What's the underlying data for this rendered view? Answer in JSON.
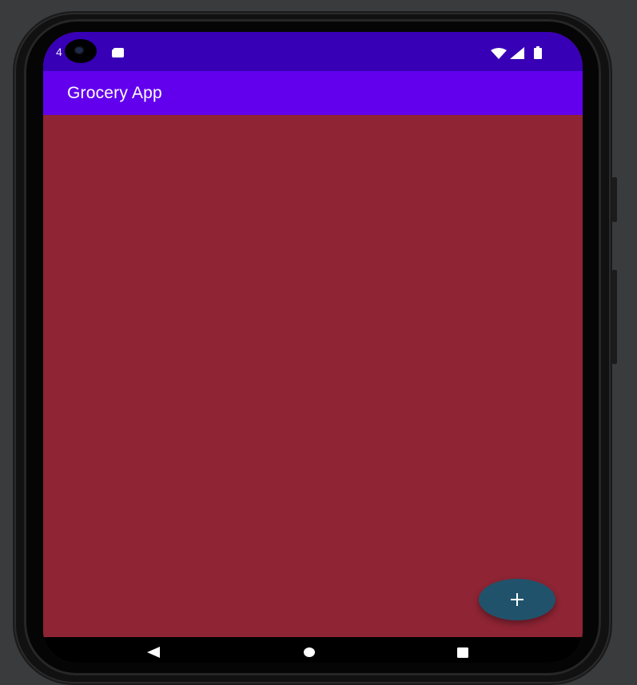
{
  "status_bar": {
    "time": "4",
    "icons": [
      "sd-card-icon",
      "wifi-icon",
      "signal-icon",
      "battery-icon"
    ]
  },
  "app_bar": {
    "title": "Grocery App"
  },
  "fab": {
    "icon": "plus-icon"
  },
  "nav_bar": {
    "icons": [
      "back-icon",
      "home-icon",
      "recents-icon"
    ]
  },
  "colors": {
    "status_bar": "#3800b6",
    "app_bar": "#6200ee",
    "content_background": "#8e2434",
    "fab": "#20536b",
    "nav_bar": "#000000"
  }
}
